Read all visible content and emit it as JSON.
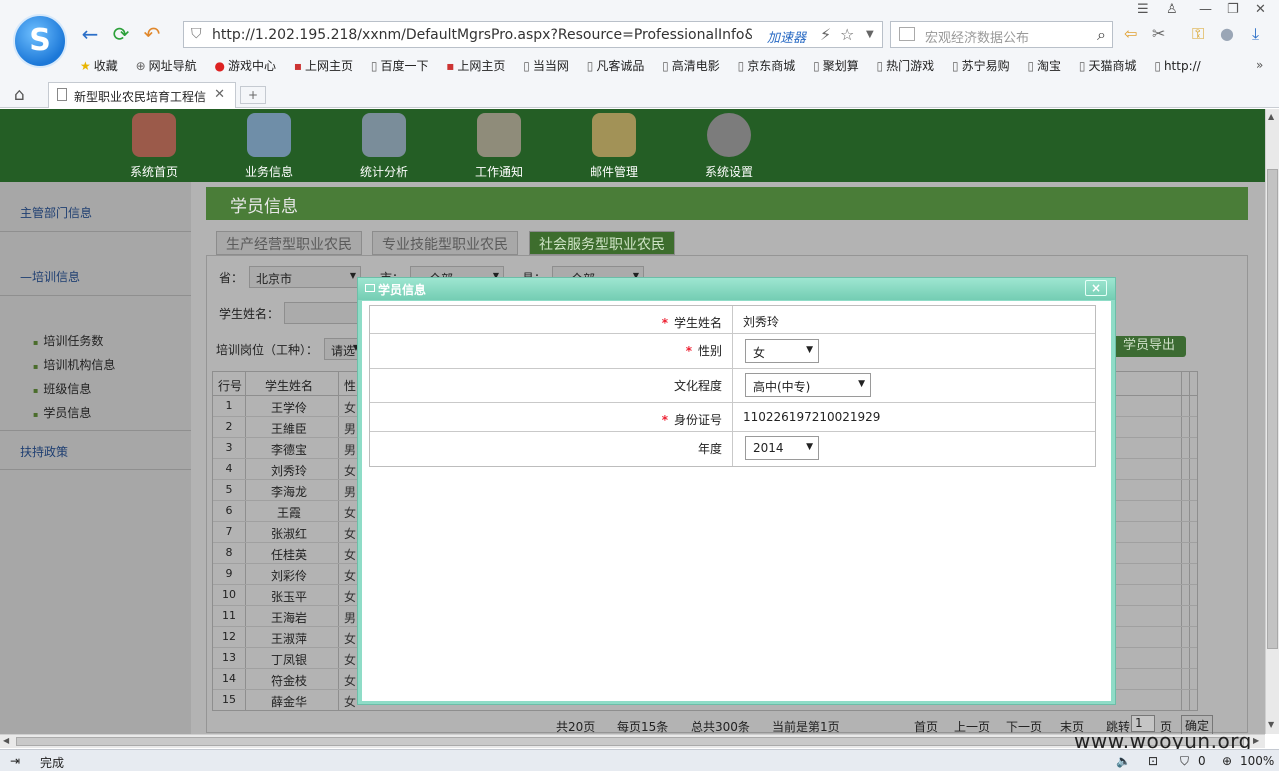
{
  "browser": {
    "url": "http://1.202.195.218/xxnm/DefaultMgrsPro.aspx?Resource=ProfessionalInfo&o=/WebSit",
    "accelerator_label": "加速器",
    "search_placeholder": "宏观经济数据公布",
    "tab_title": "新型职业农民培育工程信",
    "new_tab": "+",
    "status_text": "完成",
    "zoom": "100%",
    "zoom_count": "0",
    "bookmarks": [
      "收藏",
      "网址导航",
      "游戏中心",
      "上网主页",
      "百度一下",
      "上网主页",
      "当当网",
      "凡客诚品",
      "高清电影",
      "京东商城",
      "聚划算",
      "热门游戏",
      "苏宁易购",
      "淘宝",
      "天猫商城",
      "http://"
    ]
  },
  "topnav": {
    "items": [
      "系统首页",
      "业务信息",
      "统计分析",
      "工作通知",
      "邮件管理",
      "系统设置"
    ]
  },
  "sidebar": {
    "dept_info": "主管部门信息",
    "training_info": "培训信息",
    "training_dash": "—",
    "sub_items": [
      "培训任务数",
      "培训机构信息",
      "班级信息",
      "学员信息"
    ],
    "policy": "扶持政策"
  },
  "content": {
    "title": "学员信息",
    "tabs": [
      "生产经营型职业农民",
      "专业技能型职业农民",
      "社会服务型职业农民"
    ],
    "filters": {
      "province_label": "省：",
      "province_value": "北京市",
      "city_label": "市：",
      "city_value": "—全部—",
      "county_label": "县：",
      "county_value": "—全部—",
      "student_name_label": "学生姓名：",
      "post_label": "培训岗位（工种）：",
      "post_value": "请选"
    },
    "export_button": "学员导出",
    "table": {
      "headers": [
        "行号",
        "学生姓名",
        "性"
      ],
      "rows": [
        {
          "no": "1",
          "name": "王学伶",
          "g": "女"
        },
        {
          "no": "2",
          "name": "王維臣",
          "g": "男"
        },
        {
          "no": "3",
          "name": "李德宝",
          "g": "男"
        },
        {
          "no": "4",
          "name": "刘秀玲",
          "g": "女"
        },
        {
          "no": "5",
          "name": "李海龙",
          "g": "男"
        },
        {
          "no": "6",
          "name": "王霞",
          "g": "女"
        },
        {
          "no": "7",
          "name": "张淑红",
          "g": "女"
        },
        {
          "no": "8",
          "name": "任桂英",
          "g": "女"
        },
        {
          "no": "9",
          "name": "刘彩伶",
          "g": "女"
        },
        {
          "no": "10",
          "name": "张玉平",
          "g": "女"
        },
        {
          "no": "11",
          "name": "王海岩",
          "g": "男"
        },
        {
          "no": "12",
          "name": "王淑萍",
          "g": "女"
        },
        {
          "no": "13",
          "name": "丁凤银",
          "g": "女"
        },
        {
          "no": "14",
          "name": "符金枝",
          "g": "女"
        },
        {
          "no": "15",
          "name": "薛金华",
          "g": "女"
        }
      ]
    },
    "pager": {
      "total_pages": "共20页",
      "per_page": "每页15条",
      "total": "总共300条",
      "current": "当前是第1页",
      "first": "首页",
      "prev": "上一页",
      "next": "下一页",
      "last": "末页",
      "jump": "跳转",
      "jump_value": "1",
      "page_unit": "页",
      "confirm": "确定"
    }
  },
  "modal": {
    "title": "学员信息",
    "close": "×",
    "required_mark": "*",
    "fields": {
      "name_label": "学生姓名",
      "name_value": "刘秀玲",
      "gender_label": "性别",
      "gender_value": "女",
      "education_label": "文化程度",
      "education_value": "高中(中专)",
      "id_label": "身份证号",
      "id_value": "110226197210021929",
      "year_label": "年度",
      "year_value": "2014"
    }
  },
  "watermark": "www.wooyun.org"
}
